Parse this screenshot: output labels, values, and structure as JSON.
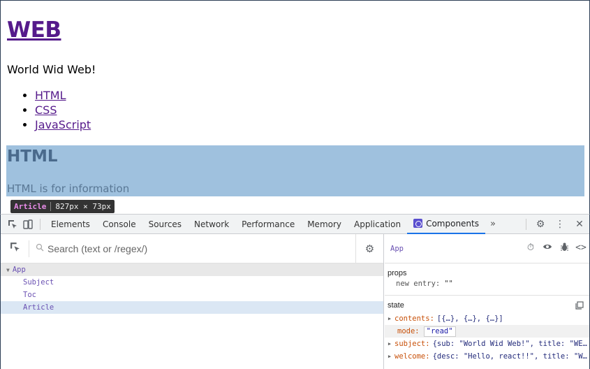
{
  "page": {
    "title": "WEB",
    "tagline": "World Wid Web!",
    "toc": [
      "HTML",
      "CSS",
      "JavaScript"
    ],
    "article": {
      "heading": "HTML",
      "text": "HTML is for information"
    },
    "tooltip": {
      "tag": "Article",
      "dims": "827px × 73px"
    }
  },
  "devtools": {
    "tabs": [
      "Elements",
      "Console",
      "Sources",
      "Network",
      "Performance",
      "Memory",
      "Application",
      "Components"
    ],
    "active_tab": "Components",
    "more": "»",
    "search": {
      "placeholder": "Search (text or /regex/)"
    },
    "tree": [
      {
        "label": "App",
        "depth": 0,
        "expanded": true
      },
      {
        "label": "Subject",
        "depth": 1
      },
      {
        "label": "Toc",
        "depth": 1
      },
      {
        "label": "Article",
        "depth": 1,
        "selected": true
      }
    ],
    "inspector": {
      "component": "App",
      "props_title": "props",
      "props": [
        {
          "key": "new entry",
          "value": "\"\""
        }
      ],
      "state_title": "state",
      "state": [
        {
          "key": "contents",
          "value": "[{…}, {…}, {…}]",
          "expandable": true
        },
        {
          "key": "mode",
          "value": "\"read\"",
          "editing": true
        },
        {
          "key": "subject",
          "value": "{sub: \"World Wid Web!\", title: \"WE…",
          "expandable": true
        },
        {
          "key": "welcome",
          "value": "{desc: \"Hello, react!!\", title: \"W…",
          "expandable": true
        }
      ]
    }
  },
  "colors": {
    "link": "#551a8b",
    "highlight": "#9fc1de",
    "tab_accent": "#1a73e8",
    "component_name": "#6a51b2",
    "state_key": "#c8510a"
  }
}
